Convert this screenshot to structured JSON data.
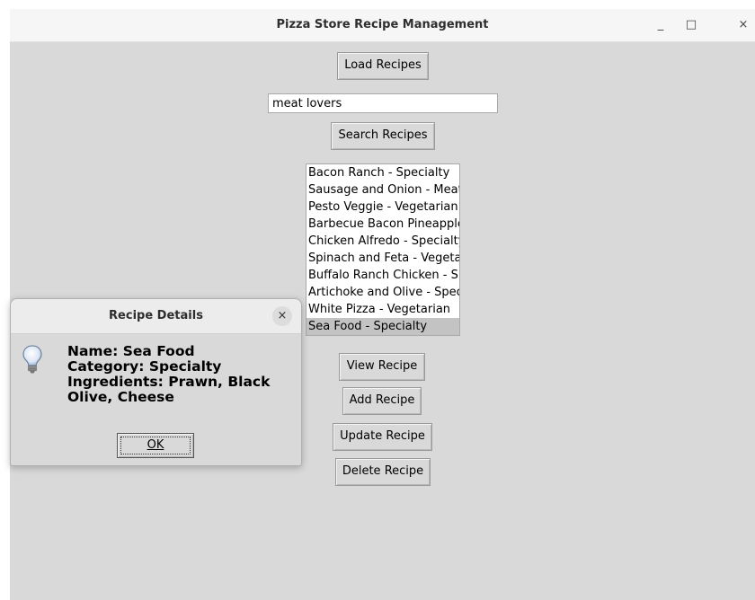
{
  "window": {
    "title": "Pizza Store Recipe Management",
    "minimize_glyph": "_",
    "maximize_glyph": "□",
    "close_glyph": "×"
  },
  "buttons": {
    "load": "Load Recipes",
    "search": "Search Recipes",
    "view": "View Recipe",
    "add": "Add Recipe",
    "update": "Update Recipe",
    "delete": "Delete Recipe"
  },
  "search": {
    "value": "meat lovers"
  },
  "recipe_list": {
    "selected_index": 9,
    "items": [
      "Bacon Ranch - Specialty",
      "Sausage and Onion - Meat",
      "Pesto Veggie - Vegetarian",
      "Barbecue Bacon Pineapple",
      "Chicken Alfredo - Specialty",
      "Spinach and Feta - Vegetarian",
      "Buffalo Ranch Chicken - Specialty",
      "Artichoke and Olive - Specialty",
      "White Pizza - Vegetarian",
      "Sea Food - Specialty"
    ]
  },
  "dialog": {
    "title": "Recipe Details",
    "close_glyph": "×",
    "icon": "lightbulb-icon",
    "message_lines": [
      "Name: Sea Food",
      "Category: Specialty",
      "Ingredients: Prawn,  Black Olive,  Cheese"
    ],
    "ok_label": "OK"
  }
}
